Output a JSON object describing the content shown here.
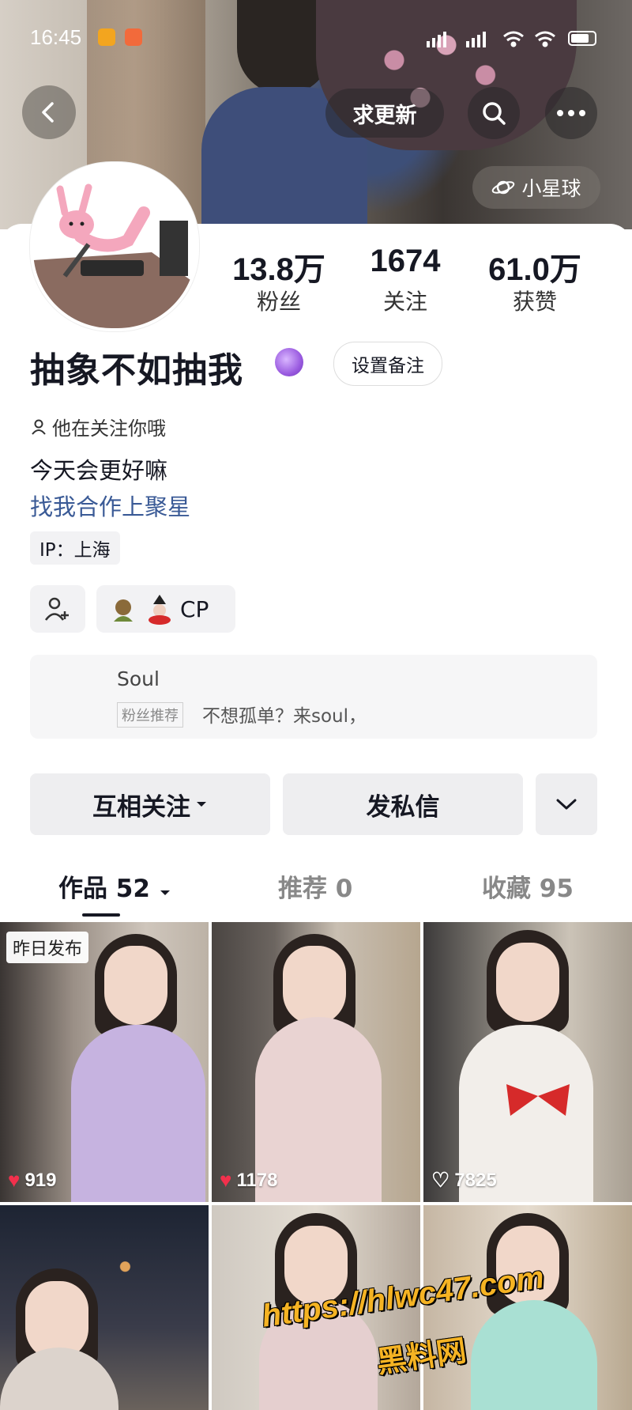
{
  "status_bar": {
    "time": "16:45",
    "battery": "battery-icon",
    "signal": "signal-icon",
    "wifi": "wifi-icon"
  },
  "top_nav": {
    "back_icon": "chevron-left-icon",
    "request_update_label": "求更新",
    "search_icon": "search-icon",
    "more_icon": "more-dots-icon",
    "planet_label": "小星球"
  },
  "profile": {
    "name": "抽象不如抽我",
    "remark_button": "设置备注",
    "stats": [
      {
        "value": "13.8万",
        "label": "粉丝"
      },
      {
        "value": "1674",
        "label": "关注"
      },
      {
        "value": "61.0万",
        "label": "获赞"
      }
    ],
    "follow_hint": "他在关注你哦",
    "bio": "今天会更好嘛",
    "bio_link": "找我合作上聚星",
    "ip": "IP：上海",
    "cp_label": "CP"
  },
  "promo": {
    "title": "Soul",
    "tag": "粉丝推荐",
    "text": "不想孤单？来soul，"
  },
  "actions": {
    "mutual_follow": "互相关注",
    "message": "发私信"
  },
  "tabs": [
    {
      "label": "作品 52",
      "active": true
    },
    {
      "label": "推荐 0",
      "active": false
    },
    {
      "label": "收藏 95",
      "active": false
    }
  ],
  "grid": [
    {
      "likes": "919",
      "liked": true,
      "badge": "昨日发布"
    },
    {
      "likes": "1178",
      "liked": true
    },
    {
      "likes": "7825",
      "liked": false
    },
    {
      "likes": ""
    },
    {
      "likes": ""
    },
    {
      "likes": ""
    }
  ],
  "watermark": {
    "url": "https://hlwc47.com",
    "name": "黑料网"
  },
  "colors": {
    "link": "#3a5a96",
    "heart": "#f2304c",
    "watermark": "#f5b323"
  }
}
